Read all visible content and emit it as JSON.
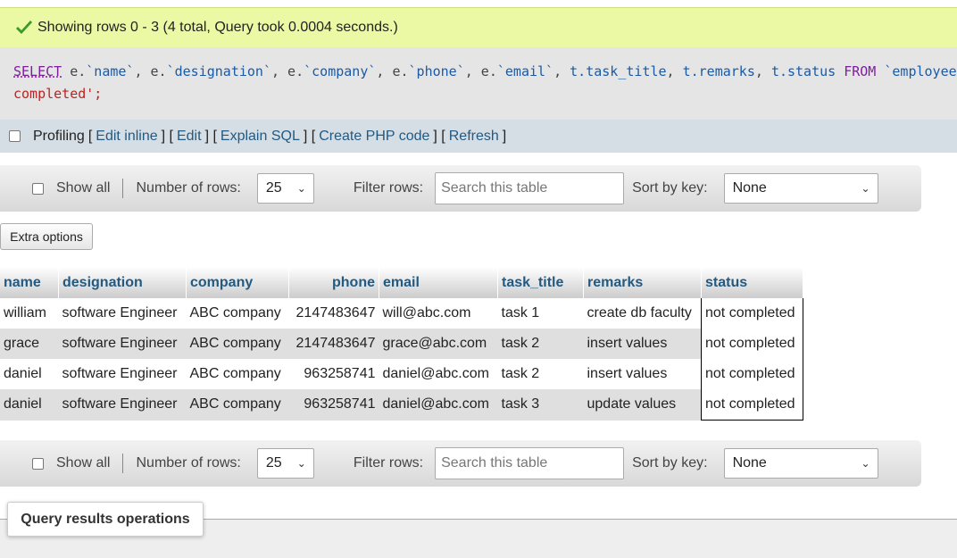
{
  "banner": {
    "message": "Showing rows 0 - 3 (4 total, Query took 0.0004 seconds.)",
    "color": "#ebf8a4"
  },
  "sql": {
    "select_kw": "SELECT",
    "line1_rest": [
      {
        "t": " e.",
        "c": "txt"
      },
      {
        "t": "`name`",
        "c": "bt"
      },
      {
        "t": ", e.",
        "c": "txt"
      },
      {
        "t": "`designation`",
        "c": "bt"
      },
      {
        "t": ", e.",
        "c": "txt"
      },
      {
        "t": "`company`",
        "c": "bt"
      },
      {
        "t": ", e.",
        "c": "txt"
      },
      {
        "t": "`phone`",
        "c": "bt"
      },
      {
        "t": ", e.",
        "c": "txt"
      },
      {
        "t": "`email`",
        "c": "bt"
      },
      {
        "t": ", ",
        "c": "txt"
      },
      {
        "t": "t.task_title",
        "c": "bt"
      },
      {
        "t": ", ",
        "c": "txt"
      },
      {
        "t": "t.remarks",
        "c": "bt"
      },
      {
        "t": ", ",
        "c": "txt"
      },
      {
        "t": "t.status",
        "c": "bt"
      },
      {
        "t": " ",
        "c": "txt"
      },
      {
        "t": "FROM",
        "c": "kw"
      },
      {
        "t": " ",
        "c": "txt"
      },
      {
        "t": "`employees",
        "c": "bt"
      }
    ],
    "line2": "completed';"
  },
  "profiling": {
    "label": "Profiling",
    "links": [
      "Edit inline",
      "Edit",
      "Explain SQL",
      "Create PHP code",
      "Refresh"
    ]
  },
  "nav": {
    "show_all": "Show all",
    "num_rows_label": "Number of rows:",
    "num_rows_value": "25",
    "filter_label": "Filter rows:",
    "filter_placeholder": "Search this table",
    "sort_label": "Sort by key:",
    "sort_value": "None"
  },
  "extra_options": "Extra options",
  "table": {
    "columns": [
      "name",
      "designation",
      "company",
      "phone",
      "email",
      "task_title",
      "remarks",
      "status"
    ],
    "rows": [
      [
        "william",
        "software Engineer",
        "ABC company",
        "2147483647",
        "will@abc.com",
        "task 1",
        "create db faculty",
        "not completed"
      ],
      [
        "grace",
        "software Engineer",
        "ABC company",
        "2147483647",
        "grace@abc.com",
        "task 2",
        "insert values",
        "not completed"
      ],
      [
        "daniel",
        "software Engineer",
        "ABC company",
        "963258741",
        "daniel@abc.com",
        "task 2",
        "insert values",
        "not completed"
      ],
      [
        "daniel",
        "software Engineer",
        "ABC company",
        "963258741",
        "daniel@abc.com",
        "task 3",
        "update values",
        "not completed"
      ]
    ]
  },
  "query_results_operations": "Query results operations",
  "colors": {
    "link": "#235a81",
    "header_text": "#235a81",
    "profiling_bar": "#d5dde5"
  }
}
